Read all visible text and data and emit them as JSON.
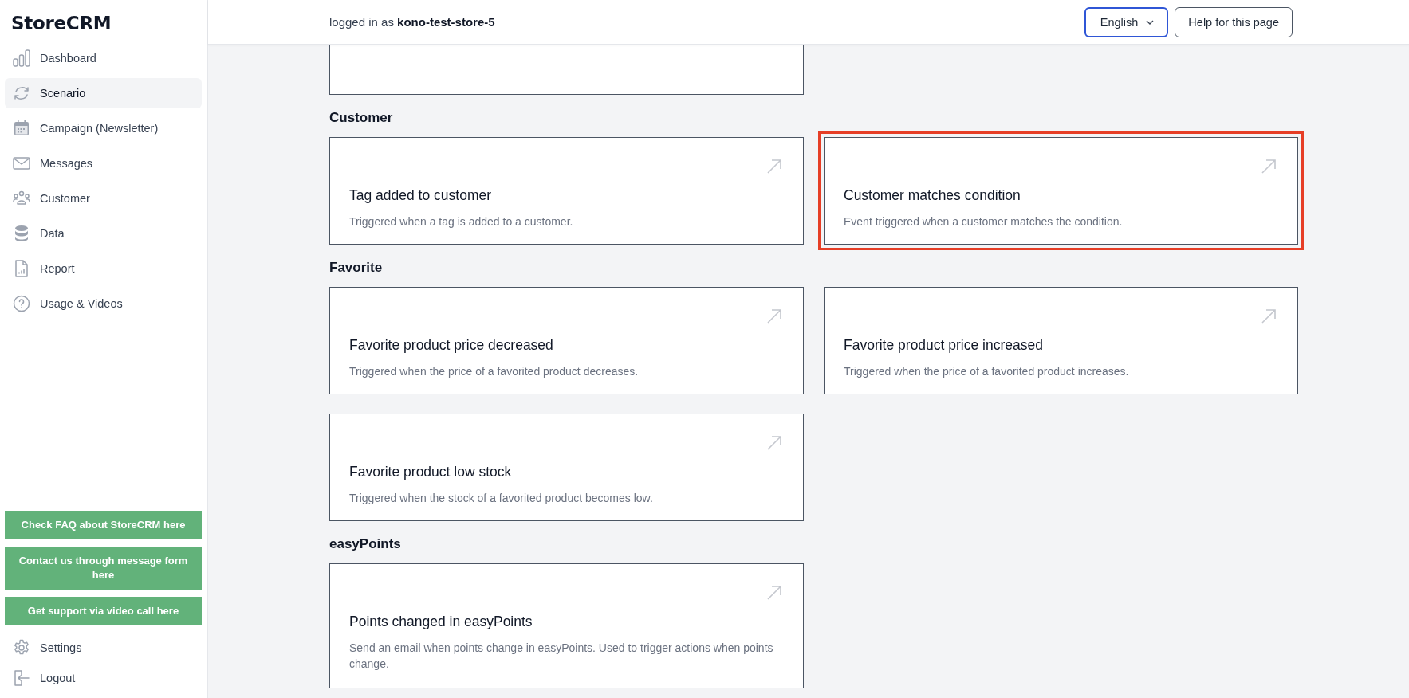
{
  "sidebar": {
    "logo": "StoreCRM",
    "nav": [
      {
        "label": "Dashboard",
        "selected": false
      },
      {
        "label": "Scenario",
        "selected": true
      },
      {
        "label": "Campaign (Newsletter)",
        "selected": false
      },
      {
        "label": "Messages",
        "selected": false
      },
      {
        "label": "Customer",
        "selected": false
      },
      {
        "label": "Data",
        "selected": false
      },
      {
        "label": "Report",
        "selected": false
      },
      {
        "label": "Usage & Videos",
        "selected": false
      }
    ],
    "support_buttons": [
      "Check FAQ about StoreCRM here",
      "Contact us through message form here",
      "Get support via video call here"
    ],
    "bottom_nav": [
      {
        "label": "Settings"
      },
      {
        "label": "Logout"
      }
    ]
  },
  "header": {
    "login_prefix": "logged in as",
    "username": "kono-test-store-5",
    "language": "English",
    "help_button": "Help for this page"
  },
  "sections": [
    {
      "cards": [
        {
          "kind": "partial"
        }
      ]
    },
    {
      "title": "Customer",
      "cards": [
        {
          "kind": "full",
          "title": "Tag added to customer",
          "description": "Triggered when a tag is added to a customer.",
          "highlighted": false
        },
        {
          "kind": "full",
          "title": "Customer matches condition",
          "description": "Event triggered when a customer matches the condition.",
          "highlighted": true
        }
      ]
    },
    {
      "title": "Favorite",
      "cards": [
        {
          "kind": "full",
          "title": "Favorite product price decreased",
          "description": "Triggered when the price of a favorited product decreases.",
          "highlighted": false
        },
        {
          "kind": "full",
          "title": "Favorite product price increased",
          "description": "Triggered when the price of a favorited product increases.",
          "highlighted": false
        },
        {
          "kind": "full",
          "title": "Favorite product low stock",
          "description": "Triggered when the stock of a favorited product becomes low.",
          "highlighted": false
        }
      ]
    },
    {
      "title": "easyPoints",
      "cards": [
        {
          "kind": "full",
          "title": "Points changed in easyPoints",
          "description": "Send an email when points change in easyPoints. Used to trigger actions when points change.",
          "highlighted": false
        }
      ]
    }
  ]
}
